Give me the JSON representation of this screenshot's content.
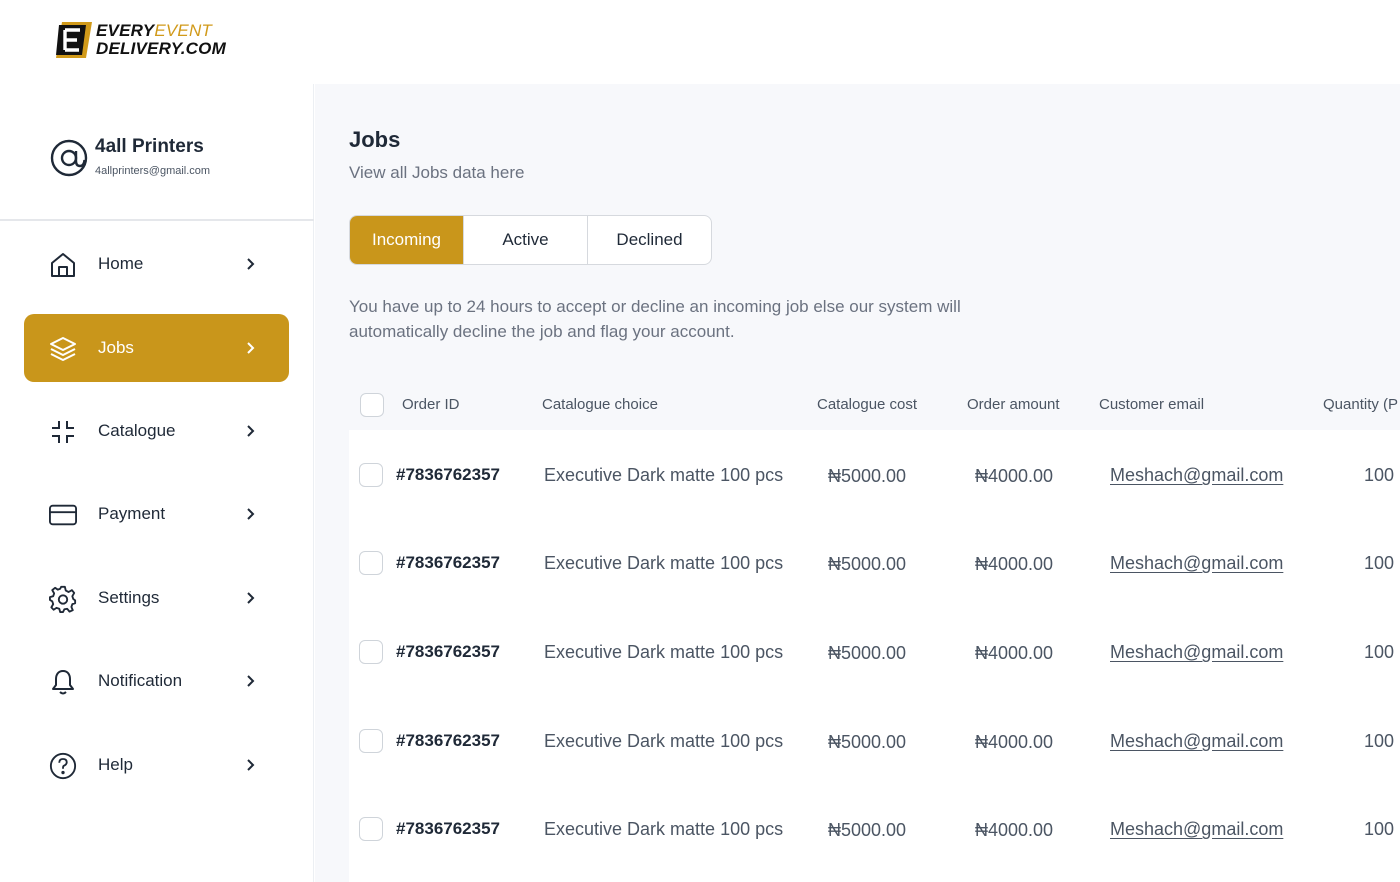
{
  "logo": {
    "line1_main": "EVERY",
    "line1_accent": "EVENT",
    "line2": "DELIVERY.COM"
  },
  "profile": {
    "name": "4all Printers",
    "email": "4allprinters@gmail.com",
    "icon": "at-sign-icon"
  },
  "sidebar": {
    "items": [
      {
        "label": "Home",
        "icon": "home-icon",
        "active": false
      },
      {
        "label": "Jobs",
        "icon": "layers-icon",
        "active": true
      },
      {
        "label": "Catalogue",
        "icon": "minimize-icon",
        "active": false
      },
      {
        "label": "Payment",
        "icon": "credit-card-icon",
        "active": false
      },
      {
        "label": "Settings",
        "icon": "gear-icon",
        "active": false
      },
      {
        "label": "Notification",
        "icon": "bell-icon",
        "active": false
      },
      {
        "label": "Help",
        "icon": "help-circle-icon",
        "active": false
      }
    ]
  },
  "main": {
    "title": "Jobs",
    "subtitle": "View all Jobs data here",
    "tabs": [
      {
        "label": "Incoming",
        "active": true
      },
      {
        "label": "Active",
        "active": false
      },
      {
        "label": "Declined",
        "active": false
      }
    ],
    "notice": "You have up to 24 hours to accept or decline an incoming job else our system will automatically decline the job and flag your account."
  },
  "table": {
    "headers": [
      "Order ID",
      "Catalogue choice",
      "Catalogue cost",
      "Order amount",
      "Customer email",
      "Quantity (P"
    ],
    "rows": [
      {
        "order_id": "#7836762357",
        "catalogue": "Executive Dark matte 100 pcs",
        "cost": "₦5000.00",
        "amount": "₦4000.00",
        "email": "Meshach@gmail.com",
        "quantity": "100"
      },
      {
        "order_id": "#7836762357",
        "catalogue": "Executive Dark matte 100 pcs",
        "cost": "₦5000.00",
        "amount": "₦4000.00",
        "email": "Meshach@gmail.com",
        "quantity": "100"
      },
      {
        "order_id": "#7836762357",
        "catalogue": "Executive Dark matte 100 pcs",
        "cost": "₦5000.00",
        "amount": "₦4000.00",
        "email": "Meshach@gmail.com",
        "quantity": "100"
      },
      {
        "order_id": "#7836762357",
        "catalogue": "Executive Dark matte 100 pcs",
        "cost": "₦5000.00",
        "amount": "₦4000.00",
        "email": "Meshach@gmail.com",
        "quantity": "100"
      },
      {
        "order_id": "#7836762357",
        "catalogue": "Executive Dark matte 100 pcs",
        "cost": "₦5000.00",
        "amount": "₦4000.00",
        "email": "Meshach@gmail.com",
        "quantity": "100"
      }
    ]
  },
  "colors": {
    "accent": "#c9961b",
    "background": "#f7f8fb",
    "text": "#1f2937",
    "muted": "#6b7280"
  }
}
